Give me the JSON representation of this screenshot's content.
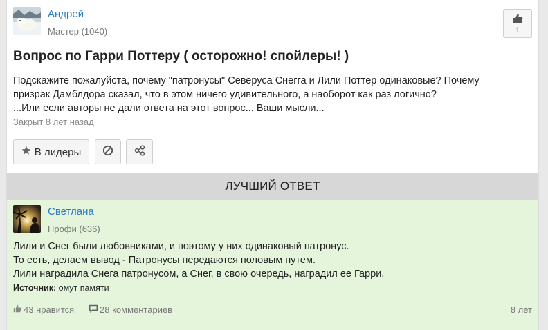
{
  "question": {
    "author": {
      "name": "Андрей",
      "rank": "Мастер (1040)"
    },
    "like_count": "1",
    "title": "Вопрос по Гарри Поттеру ( осторожно! спойлеры! )",
    "text_lines": [
      "Подскажите пожалуйста, почему \"патронусы\" Северуса Снегга и Лили Поттер одинаковые? Почему",
      "призрак Дамблдора сказал, что в этом ничего удивительного, а наоборот как раз логично?",
      "...Или если авторы не дали ответа на этот вопрос... Ваши мысли..."
    ],
    "status": "Закрыт 8 лет назад",
    "actions": {
      "leaders_label": "В лидеры"
    }
  },
  "best_answer": {
    "header": "ЛУЧШИЙ ОТВЕТ",
    "author": {
      "name": "Светлана",
      "rank": "Профи (636)"
    },
    "text_lines": [
      "Лили и Снег были любовниками, и поэтому у них одинаковый патронус.",
      "То есть, делаем вывод - Патронусы передаются половым путем.",
      "Лили наградила Снега патронусом, а Снег, в свою очередь, наградил ее Гарри."
    ],
    "source_label": "Источник:",
    "source_value": "омут памяти",
    "likes": "43 нравится",
    "comments": "28 комментариев",
    "age": "8 лет"
  },
  "colors": {
    "link": "#2b7bc9",
    "answer_bg": "#e4f5dc",
    "header_bg": "#d7d7d7"
  },
  "icons": [
    "thumbs-up-icon",
    "star-icon",
    "block-icon",
    "share-icon",
    "comment-icon"
  ]
}
